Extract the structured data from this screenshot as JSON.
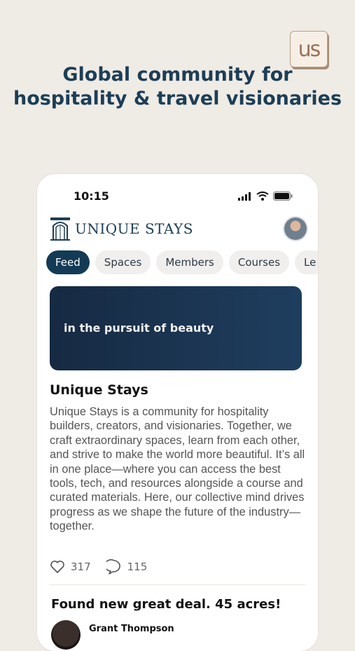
{
  "corner_logo": {
    "text": "us"
  },
  "headline": {
    "line1": "Global community for",
    "line2": "hospitality & travel visionaries"
  },
  "phone": {
    "status": {
      "time": "10:15"
    },
    "header": {
      "brand": "UNIQUE STAYS"
    },
    "tabs": [
      "Feed",
      "Spaces",
      "Members",
      "Courses",
      "Le"
    ],
    "hero": {
      "text": "in the pursuit of beauty"
    },
    "post": {
      "title": "Unique Stays",
      "body": "Unique Stays is a community for hospitality builders, creators, and visionaries. Together, we craft extraordinary spaces, learn from each other, and strive to make the world more beautiful. It’s all in one place—where you can access the best tools, tech, and resources alongside a course and curated materials. Here, our collective mind drives progress as we shape the future of the industry—together.",
      "likes": "317",
      "comments": "115"
    },
    "post2": {
      "title": "Found new great deal. 45 acres!",
      "author": "Grant Thompson"
    }
  },
  "colors": {
    "brand": "#1c3e56",
    "active_tab": "#133b55",
    "background": "#efebe5"
  },
  "icons": [
    "signal-icon",
    "wifi-icon",
    "battery-icon",
    "heart-icon",
    "comment-icon",
    "door-logo-icon"
  ]
}
